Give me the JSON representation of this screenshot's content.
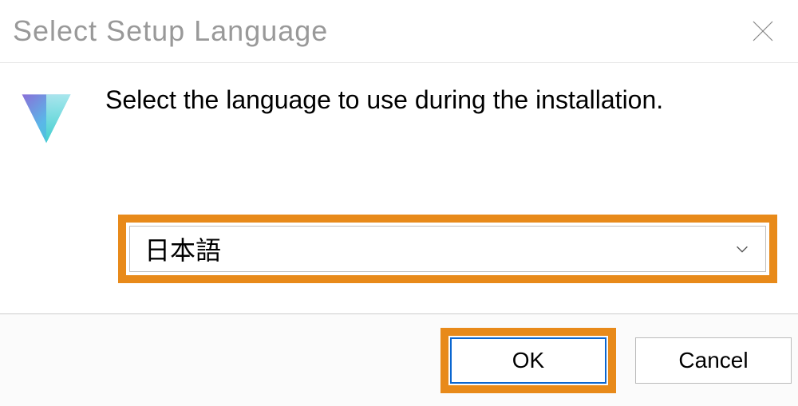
{
  "titlebar": {
    "title": "Select Setup Language"
  },
  "content": {
    "instruction": "Select the language to use during the installation."
  },
  "dropdown": {
    "selected": "日本語"
  },
  "footer": {
    "ok_label": "OK",
    "cancel_label": "Cancel"
  },
  "highlight_color": "#e88a1a",
  "icon": {
    "gradient_from": "#6a5acd",
    "gradient_mid": "#4fc3f7",
    "gradient_to": "#26c6da"
  }
}
